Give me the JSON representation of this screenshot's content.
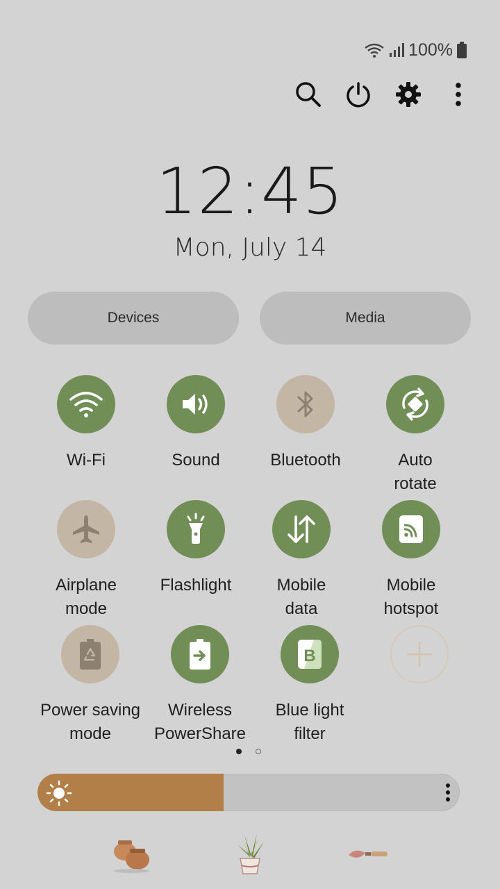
{
  "status_bar": {
    "battery_percent": "100%"
  },
  "clock": {
    "time": "12:45",
    "date": "Mon, July 14"
  },
  "pills": {
    "devices": "Devices",
    "media": "Media"
  },
  "tiles": {
    "wifi": "Wi-Fi",
    "sound": "Sound",
    "bluetooth": "Bluetooth",
    "auto_rotate": "Auto\nrotate",
    "airplane": "Airplane\nmode",
    "flashlight": "Flashlight",
    "mobile_data": "Mobile\ndata",
    "hotspot": "Mobile\nhotspot",
    "power_saving": "Power saving\nmode",
    "wireless_powershare": "Wireless\nPowerShare",
    "blue_light": "Blue light\nfilter"
  },
  "tile_states": {
    "wifi": "on",
    "sound": "on",
    "bluetooth": "off",
    "auto_rotate": "on",
    "airplane": "off",
    "flashlight": "on",
    "mobile_data": "on",
    "hotspot": "on",
    "power_saving": "off",
    "wireless_powershare": "on",
    "blue_light": "on"
  },
  "icons": {
    "status": [
      "wifi-icon",
      "signal-icon",
      "battery-icon"
    ],
    "actions": [
      "search-icon",
      "power-icon",
      "gear-icon",
      "more-vert-icon"
    ],
    "brightness": "sun-icon",
    "decorations": [
      "clay-pots-icon",
      "potted-plant-icon",
      "garden-trowel-icon"
    ]
  },
  "pager": {
    "pages": 2,
    "active": 1
  },
  "brightness": {
    "level": 0.44
  },
  "colors": {
    "background": "#d3d3d3",
    "tile_on": "#718e57",
    "tile_off": "#c3b6a5",
    "brightness_fill": "#b37f48"
  }
}
